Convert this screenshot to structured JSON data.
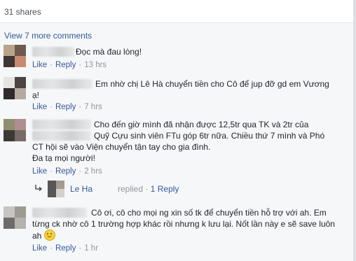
{
  "post": {
    "shares": "31 shares"
  },
  "comments_header": {
    "view_more": "View 7 more comments"
  },
  "actions": {
    "like": "Like",
    "reply": "Reply",
    "separator": "·"
  },
  "comments": [
    {
      "text": "Đọc mà đau lòng!",
      "time": "13 hrs"
    },
    {
      "lines": [
        "Em nhờ chị Lê Hà chuyển tiền cho Cô để jup đỡ gd em Vương",
        "ạ!"
      ],
      "time": "7 hrs"
    },
    {
      "lines": [
        "Cho đến giờ mình đã nhận được 12,5tr qua TK và 2tr của",
        "Quỹ Cựu sinh viên FTu góp 6tr nữa. Chiều thứ 7 mình và Phó",
        "CT hội sẽ vào Viện chuyển tận tay cho gia đình.",
        "Đa tạ mọi người!"
      ],
      "time": "2 hrs"
    },
    {
      "lines": [
        "Cô ơi, cô cho mọi ng xin số tk để chuyển tiền hỗ trợ với ah. Em",
        "từng ck nhờ cô 1 trường hợp khác rồi nhưng k lưu lại. Nốt lần này e sẽ save luôn",
        "ah"
      ],
      "time": "1 hr"
    }
  ],
  "reply_summary": {
    "name": "Le Ha",
    "replied": "replied",
    "count": "1 Reply"
  },
  "icons": {
    "reply_arrow": "reply-arrow-icon",
    "emoji": "grinning-face-icon"
  },
  "colors": {
    "link": "#365899",
    "meta": "#90949c",
    "text": "#1d2129",
    "background": "#f6f7f9"
  }
}
